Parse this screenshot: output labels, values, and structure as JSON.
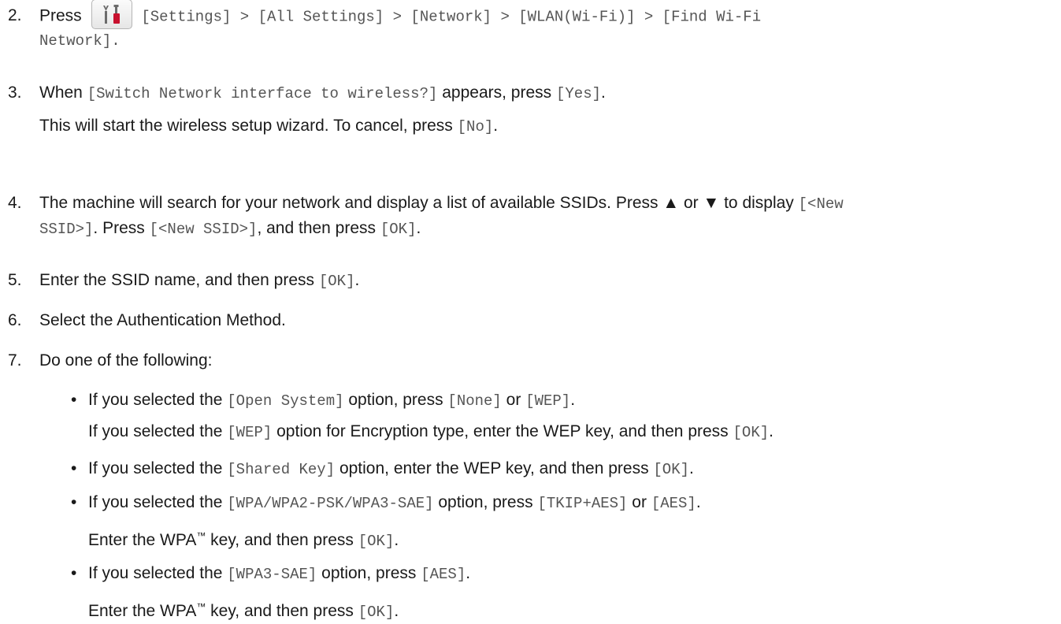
{
  "steps": [
    {
      "num": "2.",
      "press": "Press",
      "icon": "settings-tools-icon",
      "path": "[Settings] > [All Settings] > [Network] > [WLAN(Wi-Fi)] > [Find Wi-Fi",
      "path2": "Network]."
    },
    {
      "num": "3.",
      "t1": "When ",
      "c1": "[Switch Network interface to wireless?]",
      "t2": " appears, press ",
      "c2": "[Yes]",
      "t3": ".",
      "note": "This will start the wireless setup wizard. To cancel, press ",
      "note_code": "[No]",
      "note_end": "."
    },
    {
      "num": "4.",
      "t1": "The machine will search for your network and display a list of available SSIDs. Press ▲ or ▼ to display ",
      "c1": "[<New",
      "c1b": "SSID>]",
      "t2": ". Press ",
      "c2": "[<New SSID>]",
      "t3": ", and then press ",
      "c3": "[OK]",
      "t4": "."
    },
    {
      "num": "5.",
      "t1": "Enter the SSID name, and then press ",
      "c1": "[OK]",
      "t2": "."
    },
    {
      "num": "6.",
      "t1": "Select the Authentication Method."
    },
    {
      "num": "7.",
      "t1": "Do one of the following:"
    }
  ],
  "bullets": [
    {
      "t1": "If you selected the ",
      "c1": "[Open System]",
      "t2": " option, press ",
      "c2": "[None]",
      "t3": " or ",
      "c3": "[WEP]",
      "t4": ".",
      "sub": {
        "t1": "If you selected the ",
        "c1": "[WEP]",
        "t2": " option for Encryption type, enter the WEP key, and then press ",
        "c2": "[OK]",
        "t3": "."
      }
    },
    {
      "t1": "If you selected the ",
      "c1": "[Shared Key]",
      "t2": " option, enter the WEP key, and then press ",
      "c2": "[OK]",
      "t3": "."
    },
    {
      "t1": "If you selected the ",
      "c1": "[WPA/WPA2-PSK/WPA3-SAE]",
      "t2": " option, press ",
      "c2": "[TKIP+AES]",
      "t3": " or ",
      "c3": "[AES]",
      "t4": ".",
      "sub": {
        "t1": "Enter the WPA",
        "tm": "™",
        "t2": " key, and then press ",
        "c1": "[OK]",
        "t3": "."
      }
    },
    {
      "t1": "If you selected the ",
      "c1": "[WPA3-SAE]",
      "t2": " option, press ",
      "c2": "[AES]",
      "t3": ".",
      "sub": {
        "t1": "Enter the WPA",
        "tm": "™",
        "t2": " key, and then press ",
        "c1": "[OK]",
        "t3": "."
      }
    }
  ],
  "bullet_char": "•",
  "colors": {
    "text": "#1a1a1a",
    "code": "#555555",
    "icon_red": "#c8102e",
    "icon_gray": "#6b6b6b"
  }
}
